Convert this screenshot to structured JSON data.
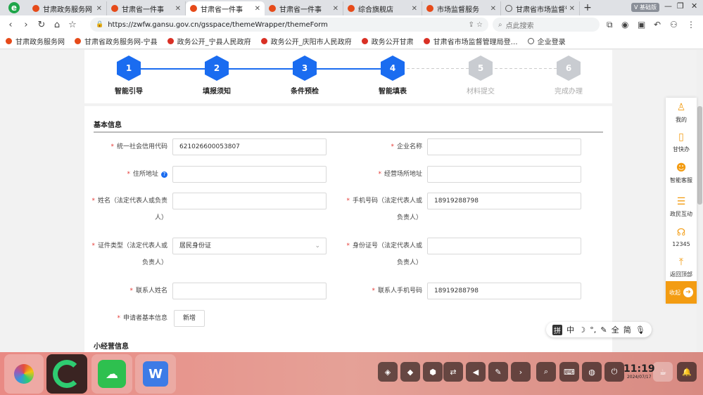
{
  "tabs": [
    {
      "label": "甘肃政务服务网",
      "active": false
    },
    {
      "label": "甘肃省一件事",
      "active": false
    },
    {
      "label": "甘肃省一件事",
      "active": true
    },
    {
      "label": "甘肃省一件事",
      "active": false
    },
    {
      "label": "综合旗舰店",
      "active": false
    },
    {
      "label": "市场监督服务",
      "active": false
    },
    {
      "label": "甘肃省市场监督管",
      "active": false
    }
  ],
  "window": {
    "badge": "V 基础版"
  },
  "addressbar": {
    "url": "https://zwfw.gansu.gov.cn/gsspace/themeWrapper/themeForm",
    "search_placeholder": "点此搜索"
  },
  "bookmarks": [
    "甘肃政务服务网",
    "甘肃省政务服务网-宁县",
    "政务公开_宁县人民政府",
    "政务公开_庆阳市人民政府",
    "政务公开甘肃",
    "甘肃省市场监督管理局登…",
    "企业登录"
  ],
  "steps": [
    {
      "num": "1",
      "label": "智能引导",
      "state": "done"
    },
    {
      "num": "2",
      "label": "填报须知",
      "state": "done"
    },
    {
      "num": "3",
      "label": "条件预检",
      "state": "done"
    },
    {
      "num": "4",
      "label": "智能填表",
      "state": "done"
    },
    {
      "num": "5",
      "label": "材料提交",
      "state": "todo"
    },
    {
      "num": "6",
      "label": "完成办理",
      "state": "todo"
    }
  ],
  "form": {
    "section_basic": "基本信息",
    "section_small": "小经营信息",
    "credit_code_label": "统一社会信用代码",
    "credit_code_value": "621026600053807",
    "company_name_label": "企业名称",
    "company_name_value": "",
    "address_label": "住所地址",
    "business_address_label": "经营场所地址",
    "name_label_1": "姓名（法定代表人或负责",
    "name_label_2": "人）",
    "phone_label_1": "手机号码（法定代表人或",
    "phone_label_2": "负责人）",
    "phone_value": "18919288798",
    "idtype_label_1": "证件类型（法定代表人或",
    "idtype_label_2": "负责人）",
    "idtype_value": "居民身份证",
    "idno_label_1": "身份证号（法定代表人或",
    "idno_label_2": "负责人）",
    "contact_name_label": "联系人姓名",
    "contact_phone_label": "联系人手机号码",
    "contact_phone_value": "18919288798",
    "applicant_label": "申请者基本信息",
    "add_button": "新增"
  },
  "float_panel": [
    {
      "label": "我的",
      "icon": "user-icon"
    },
    {
      "label": "甘快办",
      "icon": "phone-icon"
    },
    {
      "label": "智能客服",
      "icon": "robot-icon"
    },
    {
      "label": "政民互动",
      "icon": "chat-icon"
    },
    {
      "label": "12345",
      "icon": "headset-icon"
    },
    {
      "label": "返回顶部",
      "icon": "arrow-up-icon"
    }
  ],
  "fold_label": "收起",
  "ime": {
    "pin": "拼",
    "items": [
      "中",
      "☽",
      "°,",
      "✎",
      "全",
      "简",
      "🎙"
    ]
  },
  "clock": {
    "time": "11:19",
    "date": "2024/07/17"
  },
  "colors": {
    "primary": "#1a6cf0",
    "accent": "#f39c12",
    "required": "#e53935"
  }
}
